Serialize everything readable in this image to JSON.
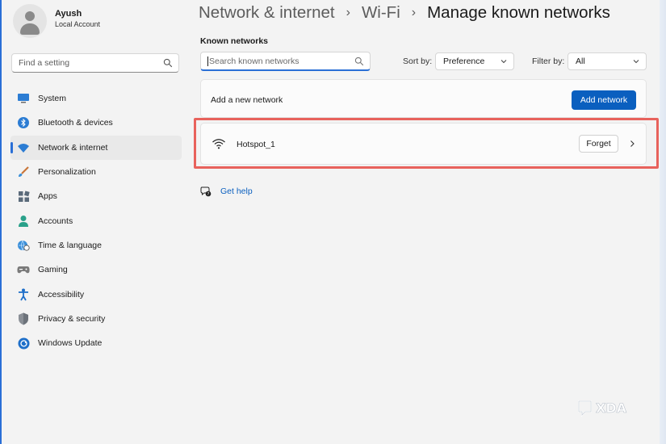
{
  "profile": {
    "name": "Ayush",
    "account_type": "Local Account"
  },
  "sidebar": {
    "search_placeholder": "Find a setting",
    "items": [
      {
        "label": "System",
        "icon": "monitor-icon"
      },
      {
        "label": "Bluetooth & devices",
        "icon": "bluetooth-icon"
      },
      {
        "label": "Network & internet",
        "icon": "wifi-icon",
        "active": true
      },
      {
        "label": "Personalization",
        "icon": "brush-icon"
      },
      {
        "label": "Apps",
        "icon": "apps-icon"
      },
      {
        "label": "Accounts",
        "icon": "person-icon"
      },
      {
        "label": "Time & language",
        "icon": "globe-clock-icon"
      },
      {
        "label": "Gaming",
        "icon": "gamepad-icon"
      },
      {
        "label": "Accessibility",
        "icon": "accessibility-icon"
      },
      {
        "label": "Privacy & security",
        "icon": "shield-icon"
      },
      {
        "label": "Windows Update",
        "icon": "update-icon"
      }
    ]
  },
  "breadcrumb": [
    "Network & internet",
    "Wi-Fi",
    "Manage known networks"
  ],
  "known_networks": {
    "title": "Known networks",
    "search_placeholder": "Search known networks",
    "sort_label": "Sort by:",
    "sort_value": "Preference",
    "filter_label": "Filter by:",
    "filter_value": "All",
    "add_label": "Add a new network",
    "add_button": "Add network",
    "networks": [
      {
        "name": "Hotspot_1",
        "forget_label": "Forget"
      }
    ]
  },
  "help": {
    "label": "Get help"
  },
  "watermark": "XDA",
  "colors": {
    "accent": "#0a5fbf",
    "active_indicator": "#2a6fd6",
    "highlight": "#e8625c"
  }
}
